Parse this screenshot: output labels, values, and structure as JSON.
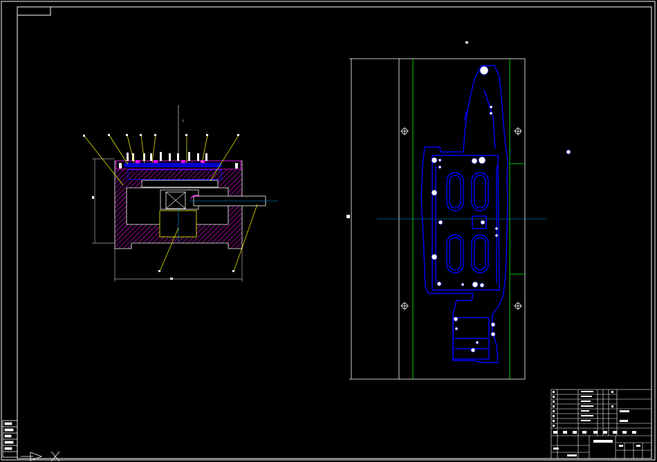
{
  "drawing": {
    "background": "#000000",
    "colors": {
      "frame": "#ffffff",
      "leader": "#ffff00",
      "part_outline": "#0000ff",
      "hatch": "#ff00ff",
      "centerline": "#00a0ff",
      "green_line": "#00ff00",
      "white_detail": "#ffffff"
    },
    "title_block": {
      "name_cell": "",
      "drawing_title": ""
    },
    "view_markers": [
      "I",
      "II"
    ],
    "leader_labels": [
      "1",
      "2",
      "3",
      "4",
      "5",
      "6",
      "7",
      "8",
      "9",
      "10"
    ]
  }
}
